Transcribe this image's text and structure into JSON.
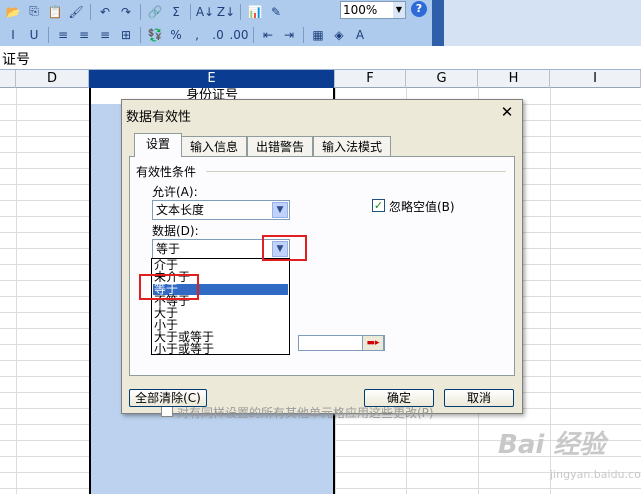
{
  "toolbar": {
    "zoom_value": "100%",
    "row1_icons": [
      "folder-icon",
      "copy-icon",
      "paste-icon",
      "format-painter-icon",
      "undo-icon",
      "redo-icon",
      "hyperlink-icon",
      "sum-icon",
      "sort-asc-icon",
      "sort-desc-icon",
      "chart-icon",
      "drawing-icon"
    ],
    "row1_glyphs": [
      "📂",
      "⎘",
      "📋",
      "🖌",
      "↶",
      "↷",
      "🔗",
      "Σ",
      "A↓",
      "Z↓",
      "📊",
      "✎"
    ],
    "row2_glyphs": [
      "I",
      "U",
      "≡",
      "≡",
      "≡",
      "⊞",
      "💱",
      "%",
      ",",
      ".0",
      ".00",
      "⇤",
      "⇥",
      "▦",
      "◈",
      "A"
    ],
    "row2_names": [
      "italic-button",
      "underline-button",
      "align-left-button",
      "align-center-button",
      "align-right-button",
      "merge-center-button",
      "currency-button",
      "percent-button",
      "comma-button",
      "increase-decimal-button",
      "decrease-decimal-button",
      "decrease-indent-button",
      "increase-indent-button",
      "borders-button",
      "fill-color-button",
      "font-color-button"
    ],
    "accent": "#aecbee"
  },
  "formula_bar": {
    "text": "证号"
  },
  "columns": [
    {
      "label": "D"
    },
    {
      "label": "E"
    },
    {
      "label": "F"
    },
    {
      "label": "G"
    },
    {
      "label": "H"
    },
    {
      "label": "I"
    }
  ],
  "cell_e1": "身份证号",
  "watermark": {
    "brand": "Bai 经验",
    "sub": "jingyan.baidu.com"
  },
  "dialog": {
    "title": "数据有效性",
    "close": "✕",
    "tabs": [
      "设置",
      "输入信息",
      "出错警告",
      "输入法模式"
    ],
    "section_title": "有效性条件",
    "allow_label": "允许(A):",
    "allow_value": "文本长度",
    "ignore_blank_label": "忽略空值(B)",
    "ignore_blank_checked": "✓",
    "data_label": "数据(D):",
    "data_value": "等于",
    "dropdown_options": [
      "介于",
      "未介于",
      "等于",
      "不等于",
      "大于",
      "小于",
      "大于或等于",
      "小于或等于"
    ],
    "dropdown_selected": "等于",
    "apply_label": "对有同样设置的所有其他单元格应用这些更改(P)",
    "clear_all": "全部清除(C)",
    "ok": "确定",
    "cancel": "取消"
  },
  "colors": {
    "selection_blue": "#bcd2ee",
    "highlight": "#316ac5",
    "annotation_red": "#e02020"
  }
}
